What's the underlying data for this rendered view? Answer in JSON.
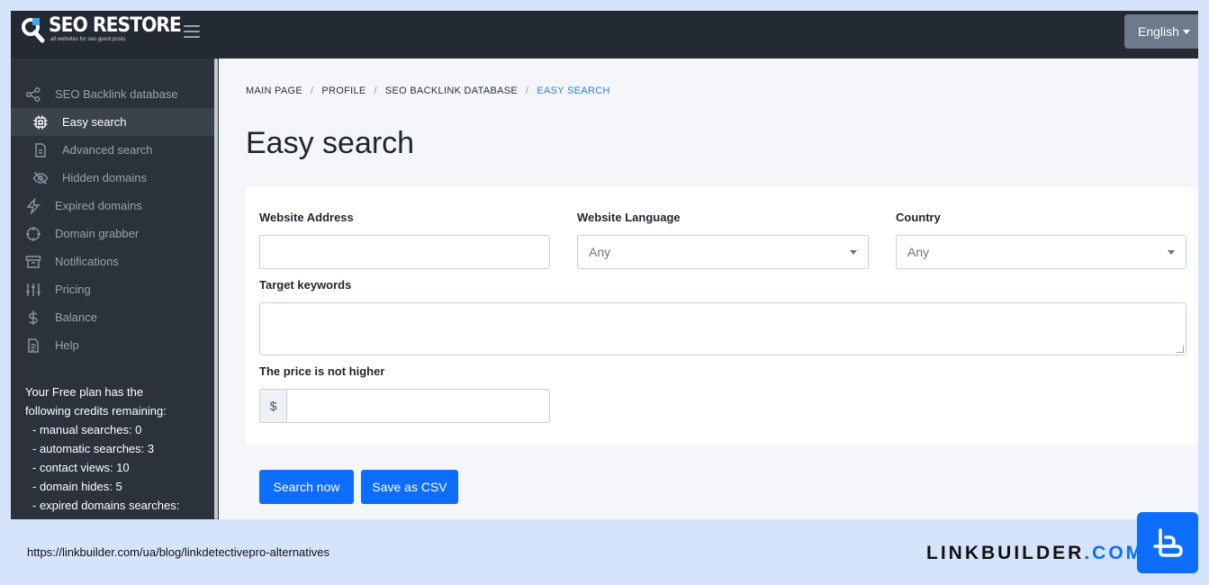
{
  "topbar": {
    "logo_title": "SEO RESTORE",
    "logo_subtitle": "all websites for seo guest posts",
    "language": "English"
  },
  "sidebar": {
    "items": [
      {
        "label": "SEO Backlink database",
        "icon": "share-nodes-icon",
        "active": false,
        "sub": false
      },
      {
        "label": "Easy search",
        "icon": "cpu-chip-icon",
        "active": true,
        "sub": true
      },
      {
        "label": "Advanced search",
        "icon": "document-icon",
        "active": false,
        "sub": true
      },
      {
        "label": "Hidden domains",
        "icon": "eye-off-icon",
        "active": false,
        "sub": true
      },
      {
        "label": "Expired domains",
        "icon": "lightning-icon",
        "active": false,
        "sub": false
      },
      {
        "label": "Domain grabber",
        "icon": "crosshair-icon",
        "active": false,
        "sub": false
      },
      {
        "label": "Notifications",
        "icon": "archive-box-icon",
        "active": false,
        "sub": false
      },
      {
        "label": "Pricing",
        "icon": "sliders-icon",
        "active": false,
        "sub": false
      },
      {
        "label": "Balance",
        "icon": "dollar-icon",
        "active": false,
        "sub": false
      },
      {
        "label": "Help",
        "icon": "document-text-icon",
        "active": false,
        "sub": false
      }
    ],
    "credits": {
      "intro_1": "Your Free plan has the",
      "intro_2": "following credits remaining:",
      "lines": [
        "- manual searches: 0",
        "- automatic searches: 3",
        "- contact views: 10",
        "- domain hides: 5",
        "- expired domains searches:"
      ]
    }
  },
  "breadcrumb": [
    "MAIN PAGE",
    "PROFILE",
    "SEO BACKLINK DATABASE",
    "EASY SEARCH"
  ],
  "breadcrumb_sep": "/",
  "page_title": "Easy search",
  "form": {
    "website_address_label": "Website Address",
    "website_address_value": "",
    "website_language_label": "Website Language",
    "website_language_value": "Any",
    "country_label": "Country",
    "country_value": "Any",
    "target_keywords_label": "Target keywords",
    "price_label": "The price is not higher",
    "price_prefix": "$"
  },
  "buttons": {
    "search_now": "Search now",
    "save_csv": "Save as CSV"
  },
  "footer": {
    "url": "https://linkbuilder.com/ua/blog/linkdetectivepro-alternatives",
    "brand_main": "LINKBUILDER",
    "brand_dot": ".",
    "brand_tld": "COM"
  },
  "colors": {
    "accent": "#0d6efd",
    "topbar": "#232a33",
    "sidebar": "#2b323b",
    "banner": "#d6e4fb"
  }
}
